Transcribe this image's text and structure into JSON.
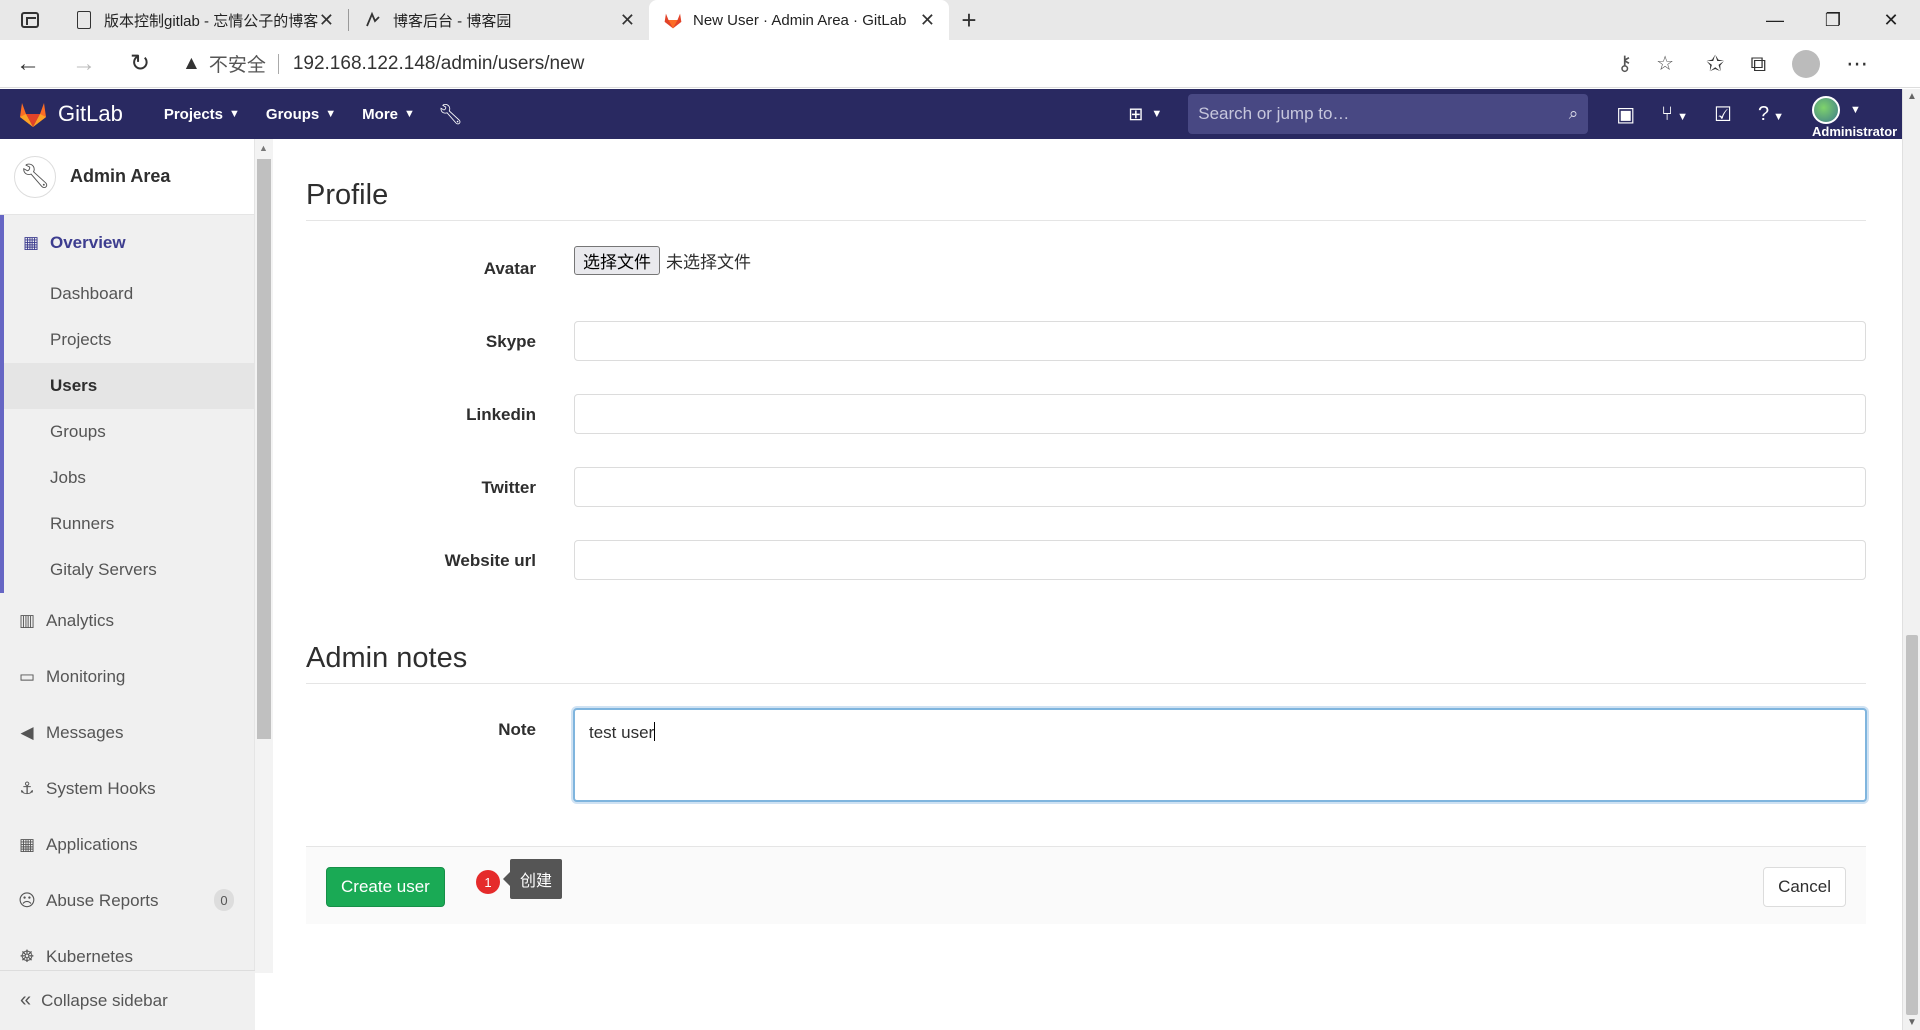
{
  "browser": {
    "tabs": [
      {
        "title": "版本控制gitlab - 忘情公子的博客"
      },
      {
        "title": "博客后台 - 博客园"
      },
      {
        "title": "New User · Admin Area · GitLab"
      }
    ],
    "close_glyph": "✕",
    "new_tab_glyph": "+",
    "insecure_label": "不安全",
    "url": "192.168.122.148/admin/users/new",
    "window_controls": [
      "—",
      "❐",
      "✕"
    ]
  },
  "header": {
    "brand": "GitLab",
    "nav": [
      {
        "label": "Projects"
      },
      {
        "label": "Groups"
      },
      {
        "label": "More"
      }
    ],
    "search_placeholder": "Search or jump to…",
    "user_name": "Administrator"
  },
  "sidebar": {
    "title": "Admin Area",
    "overview": "Overview",
    "overview_items": [
      {
        "label": "Dashboard",
        "active": false
      },
      {
        "label": "Projects",
        "active": false
      },
      {
        "label": "Users",
        "active": true
      },
      {
        "label": "Groups",
        "active": false
      },
      {
        "label": "Jobs",
        "active": false
      },
      {
        "label": "Runners",
        "active": false
      },
      {
        "label": "Gitaly Servers",
        "active": false
      }
    ],
    "items": [
      {
        "label": "Analytics",
        "icon": "chart-icon"
      },
      {
        "label": "Monitoring",
        "icon": "monitor-icon"
      },
      {
        "label": "Messages",
        "icon": "megaphone-icon"
      },
      {
        "label": "System Hooks",
        "icon": "hook-icon"
      },
      {
        "label": "Applications",
        "icon": "grid-icon"
      },
      {
        "label": "Abuse Reports",
        "icon": "face-icon",
        "badge": "0"
      },
      {
        "label": "Kubernetes",
        "icon": "kubernetes-icon"
      }
    ],
    "collapse": "Collapse sidebar"
  },
  "profile": {
    "title": "Profile",
    "avatar_label": "Avatar",
    "file_button": "选择文件",
    "file_none": "未选择文件",
    "fields": [
      {
        "label": "Skype",
        "value": ""
      },
      {
        "label": "Linkedin",
        "value": ""
      },
      {
        "label": "Twitter",
        "value": ""
      },
      {
        "label": "Website url",
        "value": ""
      }
    ]
  },
  "admin_notes": {
    "title": "Admin notes",
    "note_label": "Note",
    "note_value": "test user"
  },
  "actions": {
    "create": "Create user",
    "cancel": "Cancel",
    "annotation_number": "1",
    "annotation_text": "创建"
  },
  "colors": {
    "header_bg": "#292961",
    "create_green": "#1aaa55",
    "annotation_red": "#e52b2b"
  }
}
